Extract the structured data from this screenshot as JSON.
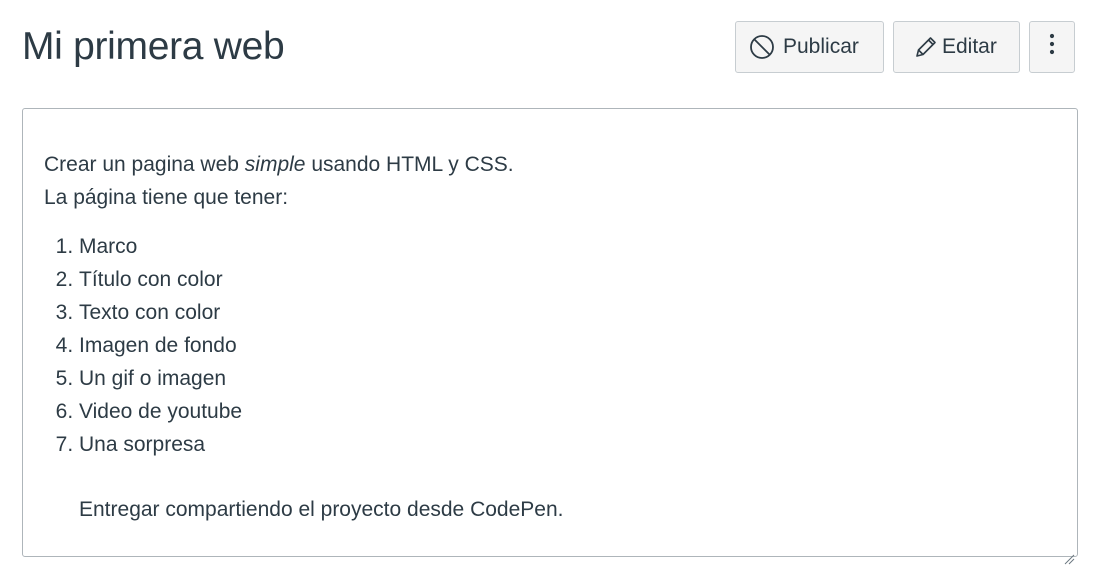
{
  "header": {
    "title": "Mi primera web"
  },
  "toolbar": {
    "publish_label": "Publicar",
    "edit_label": "Editar",
    "more_icon": "kebab-menu-icon",
    "publish_icon": "unpublished-icon",
    "edit_icon": "pencil-icon"
  },
  "content": {
    "intro_before": "Crear un pagina web ",
    "intro_emphasis": "simple",
    "intro_after": " usando HTML y CSS.",
    "intro_line2": "La página tiene que tener:",
    "steps": [
      "Marco",
      "Título con color",
      "Texto con color",
      "Imagen de fondo",
      "Un gif o imagen",
      "Video de youtube",
      "Una sorpresa"
    ],
    "note": "Entregar compartiendo el proyecto desde CodePen."
  }
}
